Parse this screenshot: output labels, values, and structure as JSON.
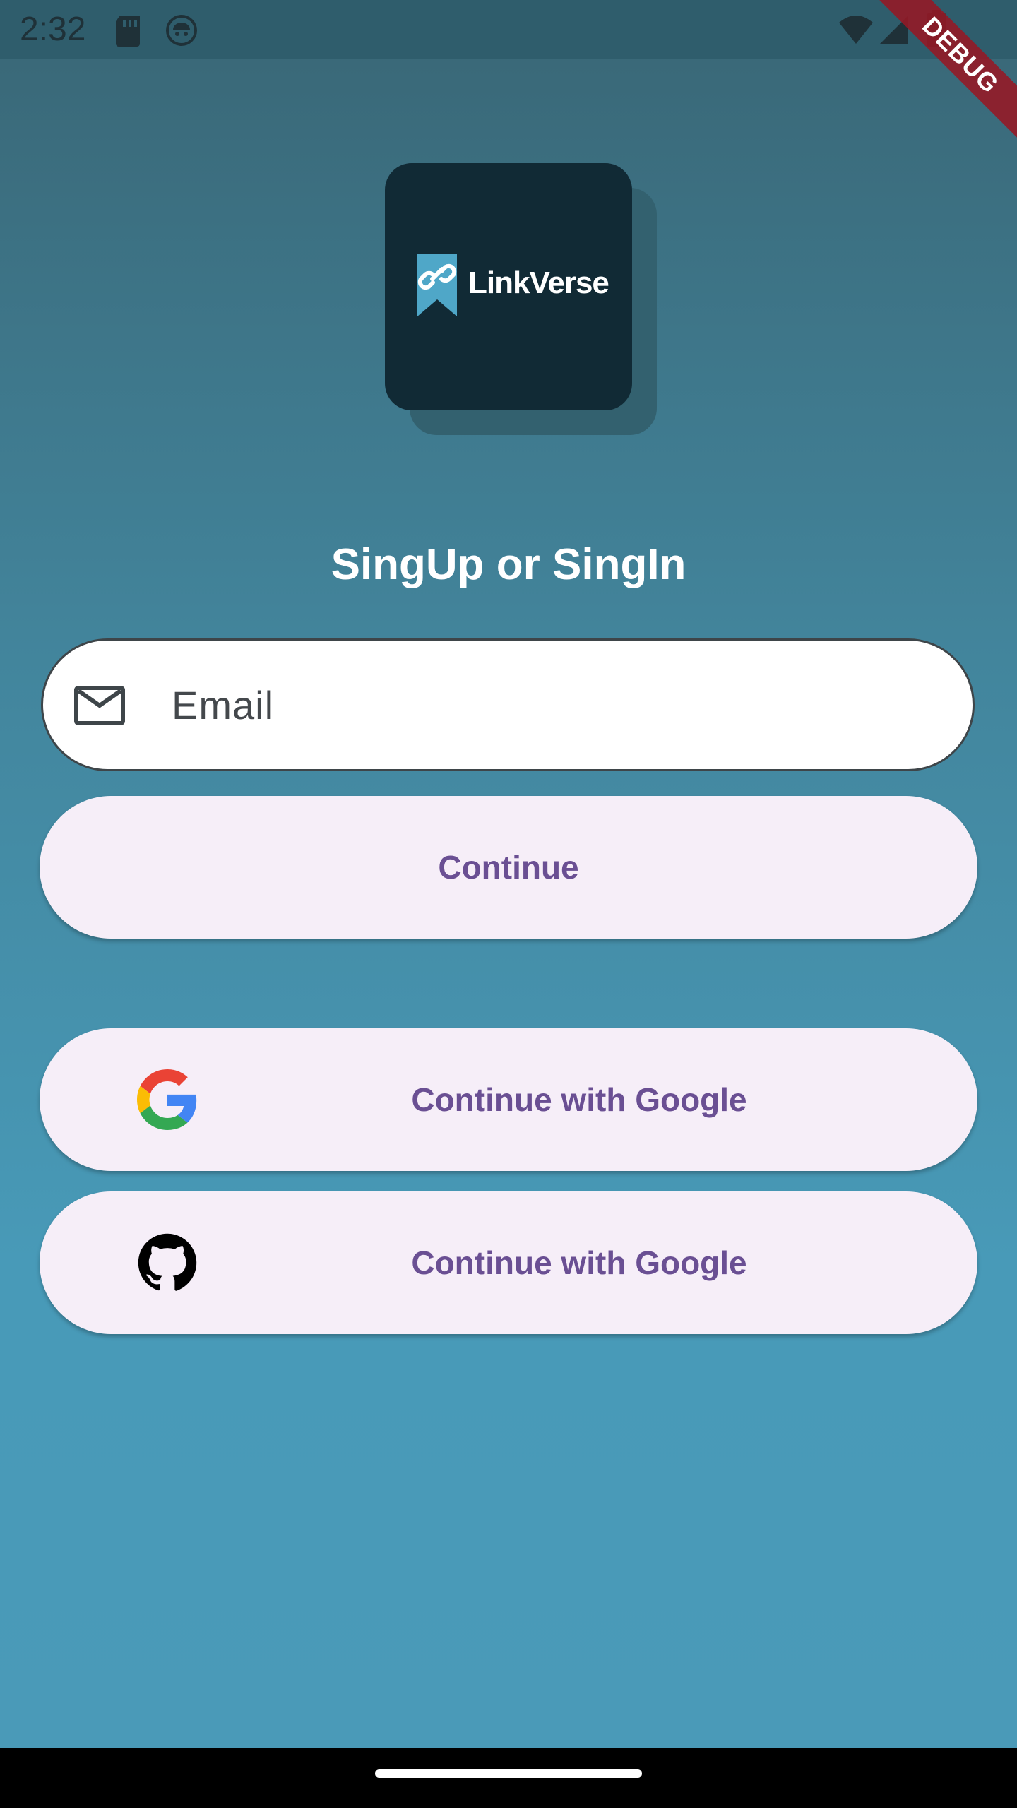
{
  "status_bar": {
    "time": "2:32",
    "icons": [
      "sd-card-icon",
      "debug-bug-icon",
      "wifi-icon",
      "signal-icon",
      "battery-icon"
    ]
  },
  "debug_banner": {
    "label": "DEBUG"
  },
  "logo": {
    "text": "LinkVerse",
    "icon": "bookmark-link-icon"
  },
  "title": "SingUp or SingIn",
  "email_field": {
    "placeholder": "Email",
    "value": "",
    "icon": "mail-icon"
  },
  "buttons": {
    "continue": "Continue",
    "google": {
      "label": "Continue with Google",
      "icon": "google-icon"
    },
    "github": {
      "label": "Continue with Google",
      "icon": "github-icon"
    }
  },
  "colors": {
    "accent_text": "#6a4f93",
    "button_bg": "#f6eef8",
    "logo_bg": "#112a35",
    "debug_red": "#961824"
  }
}
